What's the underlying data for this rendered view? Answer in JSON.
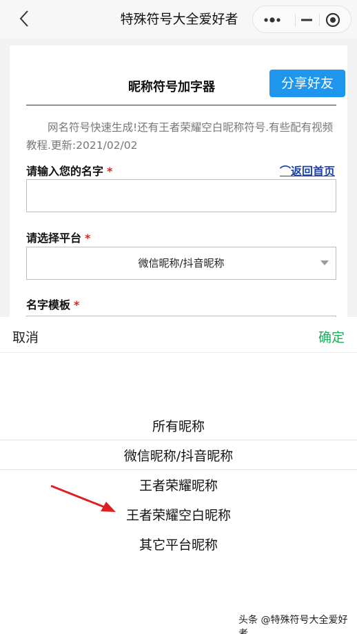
{
  "navbar": {
    "title": "特殊符号大全爱好者",
    "back_icon": "chevron-left-icon",
    "capsule_icons": [
      "more-dots-icon",
      "minimize-icon",
      "close-target-icon"
    ]
  },
  "card": {
    "title": "昵称符号加字器",
    "share_label": "分享好友",
    "description": "网名符号快速生成!还有王者荣耀空白昵称符号.有些配有视频教程.更新:2021/02/02",
    "name_label": "请输入您的名字",
    "required_mark": "*",
    "back_home_label": "⌒返回首页",
    "name_value": "",
    "platform_label": "请选择平台",
    "platform_value": "微信昵称/抖音昵称",
    "template_label": "名字模板"
  },
  "picker": {
    "cancel_label": "取消",
    "confirm_label": "确定",
    "options": [
      "所有昵称",
      "微信昵称/抖音昵称",
      "王者荣耀昵称",
      "王者荣耀空白昵称",
      "其它平台昵称"
    ],
    "selected_index": 1
  },
  "watermark": "头条 @特殊符号大全爱好者",
  "colors": {
    "share_button": "#1e96ee",
    "confirm": "#1aad5a",
    "required": "#e02020",
    "link": "#1a3fae",
    "arrow": "#e02020"
  }
}
